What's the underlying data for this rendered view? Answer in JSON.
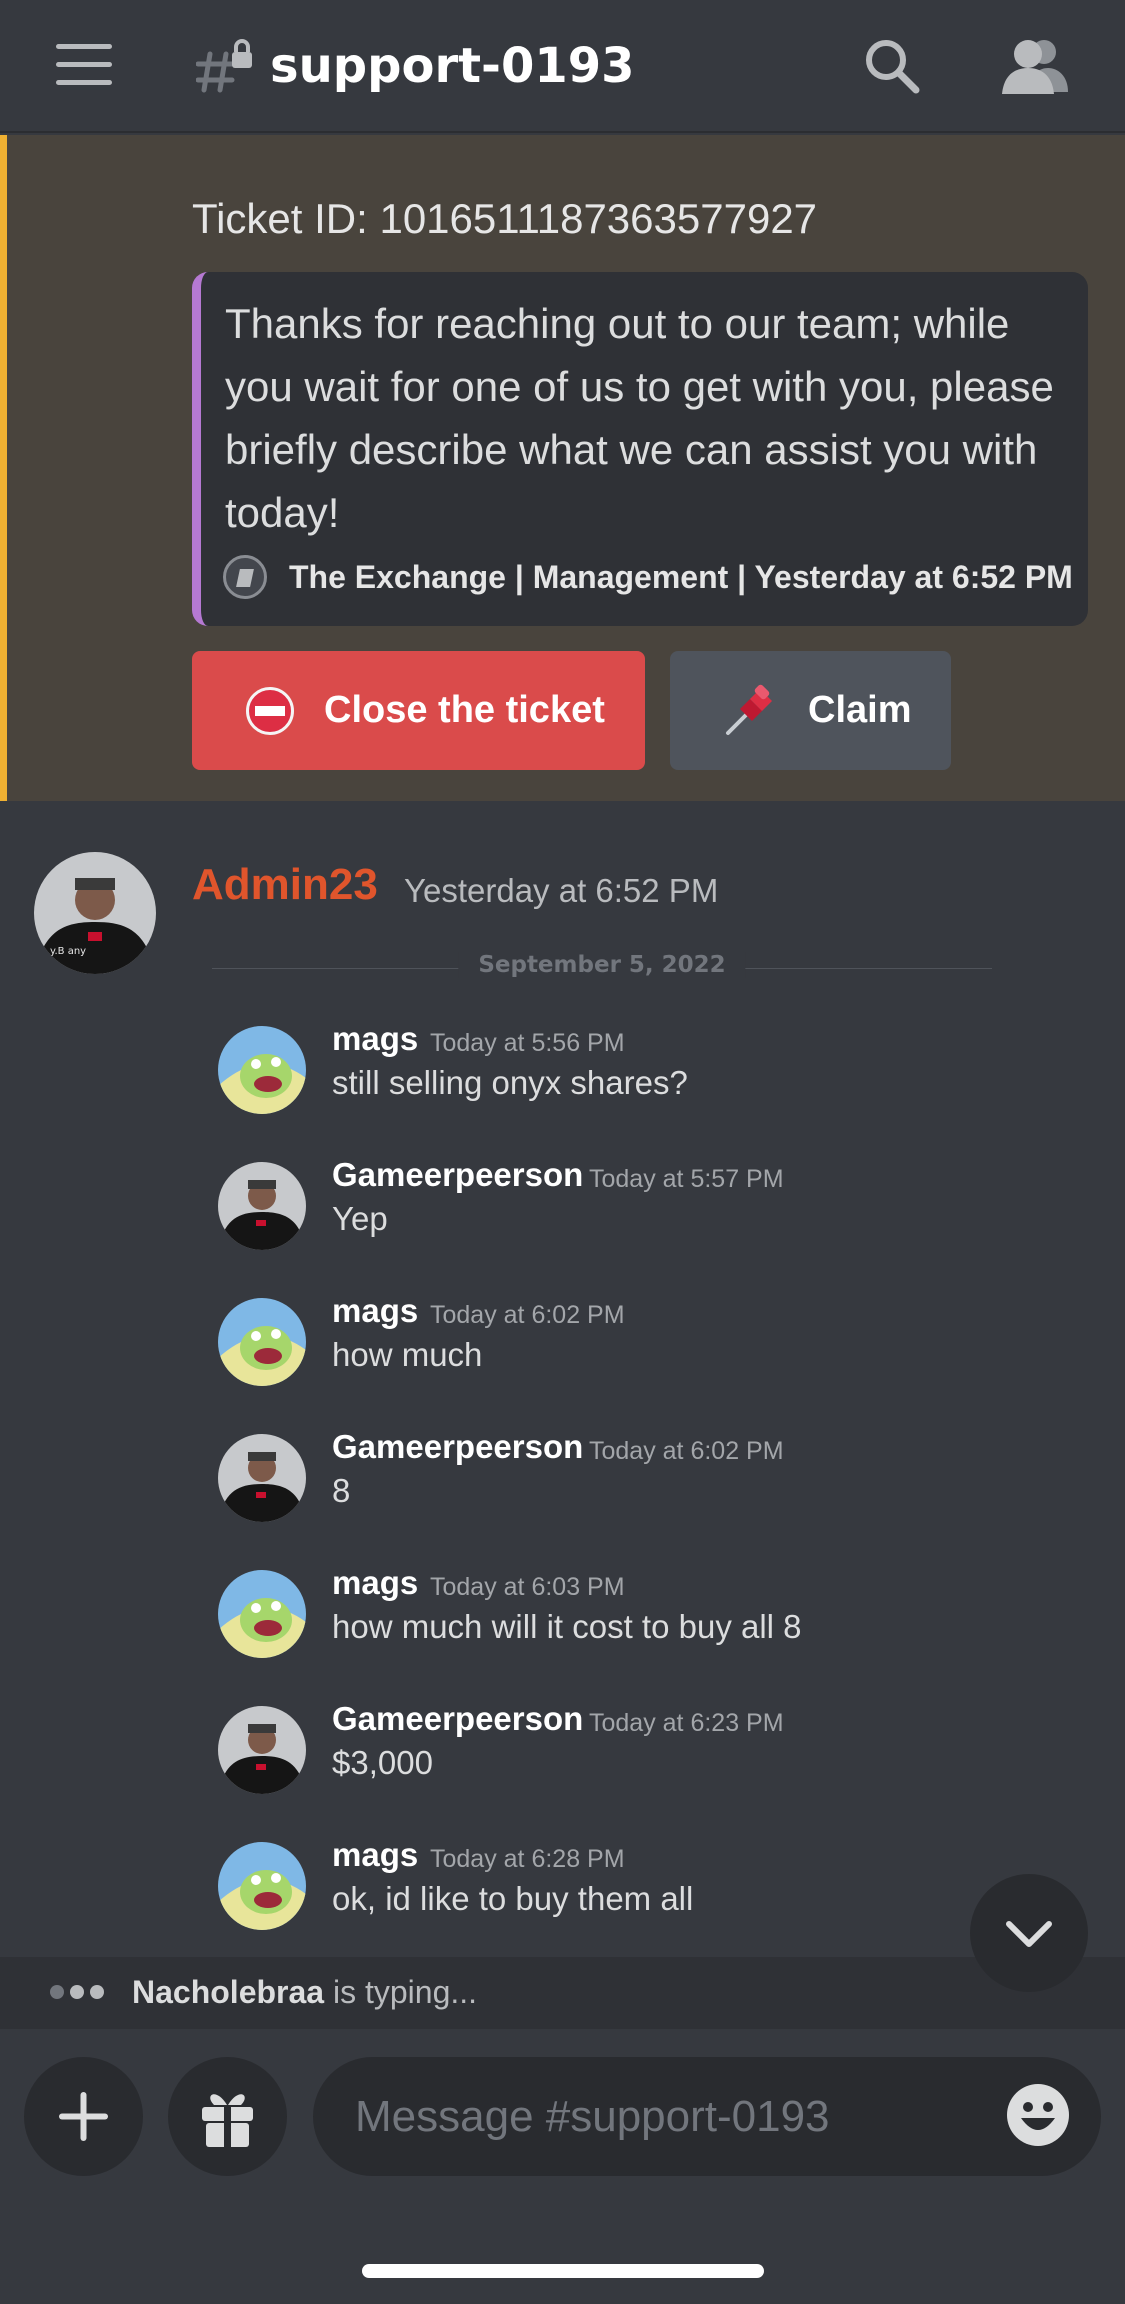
{
  "header": {
    "channel_name": "support-0193"
  },
  "embed": {
    "ticket_id": "Ticket ID: 1016511187363577927",
    "description": "Thanks for reaching out to our team; while you wait for one of us to get with you, please briefly describe what we can assist you with today!",
    "footer": "The Exchange | Management | Yesterday at 6:52 PM",
    "close_button": "Close the ticket",
    "claim_button": "Claim"
  },
  "post": {
    "author": "Admin23",
    "time": "Yesterday at 6:52 PM",
    "date_divider": "September 5, 2022"
  },
  "messages": [
    {
      "author": "mags",
      "time": "Today at 5:56 PM",
      "content": "still selling onyx shares?"
    },
    {
      "author": "Gameerpeerson",
      "time": "Today at 5:57 PM",
      "content": "Yep"
    },
    {
      "author": "mags",
      "time": "Today at 6:02 PM",
      "content": "how much"
    },
    {
      "author": "Gameerpeerson",
      "time": "Today at 6:02 PM",
      "content": "8"
    },
    {
      "author": "mags",
      "time": "Today at 6:03 PM",
      "content": "how much will it cost to buy all 8"
    },
    {
      "author": "Gameerpeerson",
      "time": "Today at 6:23 PM",
      "content": "$3,000"
    },
    {
      "author": "mags",
      "time": "Today at 6:28 PM",
      "content": "ok, id like to buy them all"
    }
  ],
  "typing": {
    "user": "Nacholebraa",
    "suffix": " is typing..."
  },
  "composer": {
    "placeholder": "Message #support-0193"
  },
  "colors": {
    "background": "#36393f",
    "embed_background": "#49443d",
    "embed_accent": "#f0b132",
    "embed_card_accent": "#b579d2",
    "danger_button": "#da4b4b",
    "secondary_button": "#4f545c",
    "admin_name": "#e0552c"
  },
  "icons": [
    "hamburger-menu-icon",
    "locked-channel-icon",
    "search-icon",
    "members-icon",
    "no-entry-icon",
    "pushpin-icon",
    "chevron-down-icon",
    "plus-icon",
    "gift-icon",
    "emoji-icon"
  ]
}
